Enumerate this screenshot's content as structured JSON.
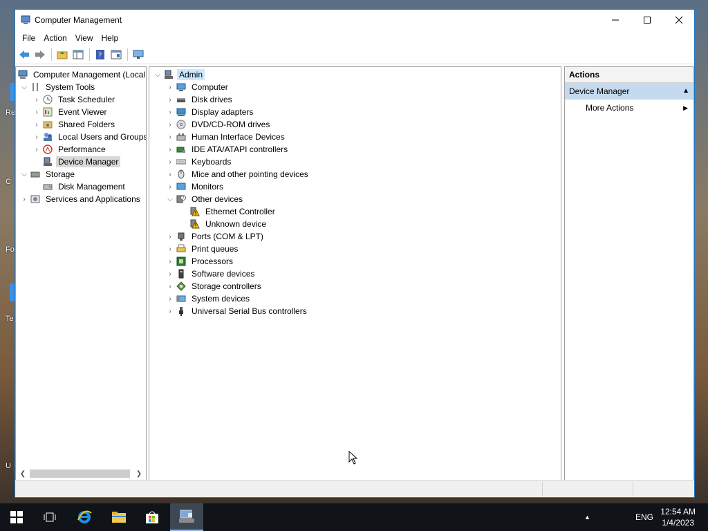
{
  "window": {
    "title": "Computer Management"
  },
  "menu": [
    "File",
    "Action",
    "View",
    "Help"
  ],
  "toolbar": [
    "back-icon",
    "forward-icon",
    "up-folder-icon",
    "show-hide-tree-icon",
    "help-icon",
    "properties-icon",
    "monitor-icon"
  ],
  "tree": {
    "root": "Computer Management (Local",
    "system_tools": "System Tools",
    "items": [
      "Task Scheduler",
      "Event Viewer",
      "Shared Folders",
      "Local Users and Groups",
      "Performance",
      "Device Manager"
    ],
    "storage": "Storage",
    "disk_management": "Disk Management",
    "services": "Services and Applications"
  },
  "devices": {
    "root": "Admin",
    "categories": [
      "Computer",
      "Disk drives",
      "Display adapters",
      "DVD/CD-ROM drives",
      "Human Interface Devices",
      "IDE ATA/ATAPI controllers",
      "Keyboards",
      "Mice and other pointing devices",
      "Monitors",
      "Other devices"
    ],
    "other_devices": [
      "Ethernet Controller",
      "Unknown device"
    ],
    "categories_after": [
      "Ports (COM & LPT)",
      "Print queues",
      "Processors",
      "Software devices",
      "Storage controllers",
      "System devices",
      "Universal Serial Bus controllers"
    ]
  },
  "actions": {
    "header": "Actions",
    "section": "Device Manager",
    "more": "More Actions"
  },
  "taskbar": {
    "lang": "ENG",
    "time": "12:54 AM",
    "date": "1/4/2023"
  },
  "desktop_fragments": [
    "Re",
    "C",
    "Fo",
    "Te",
    "U"
  ]
}
